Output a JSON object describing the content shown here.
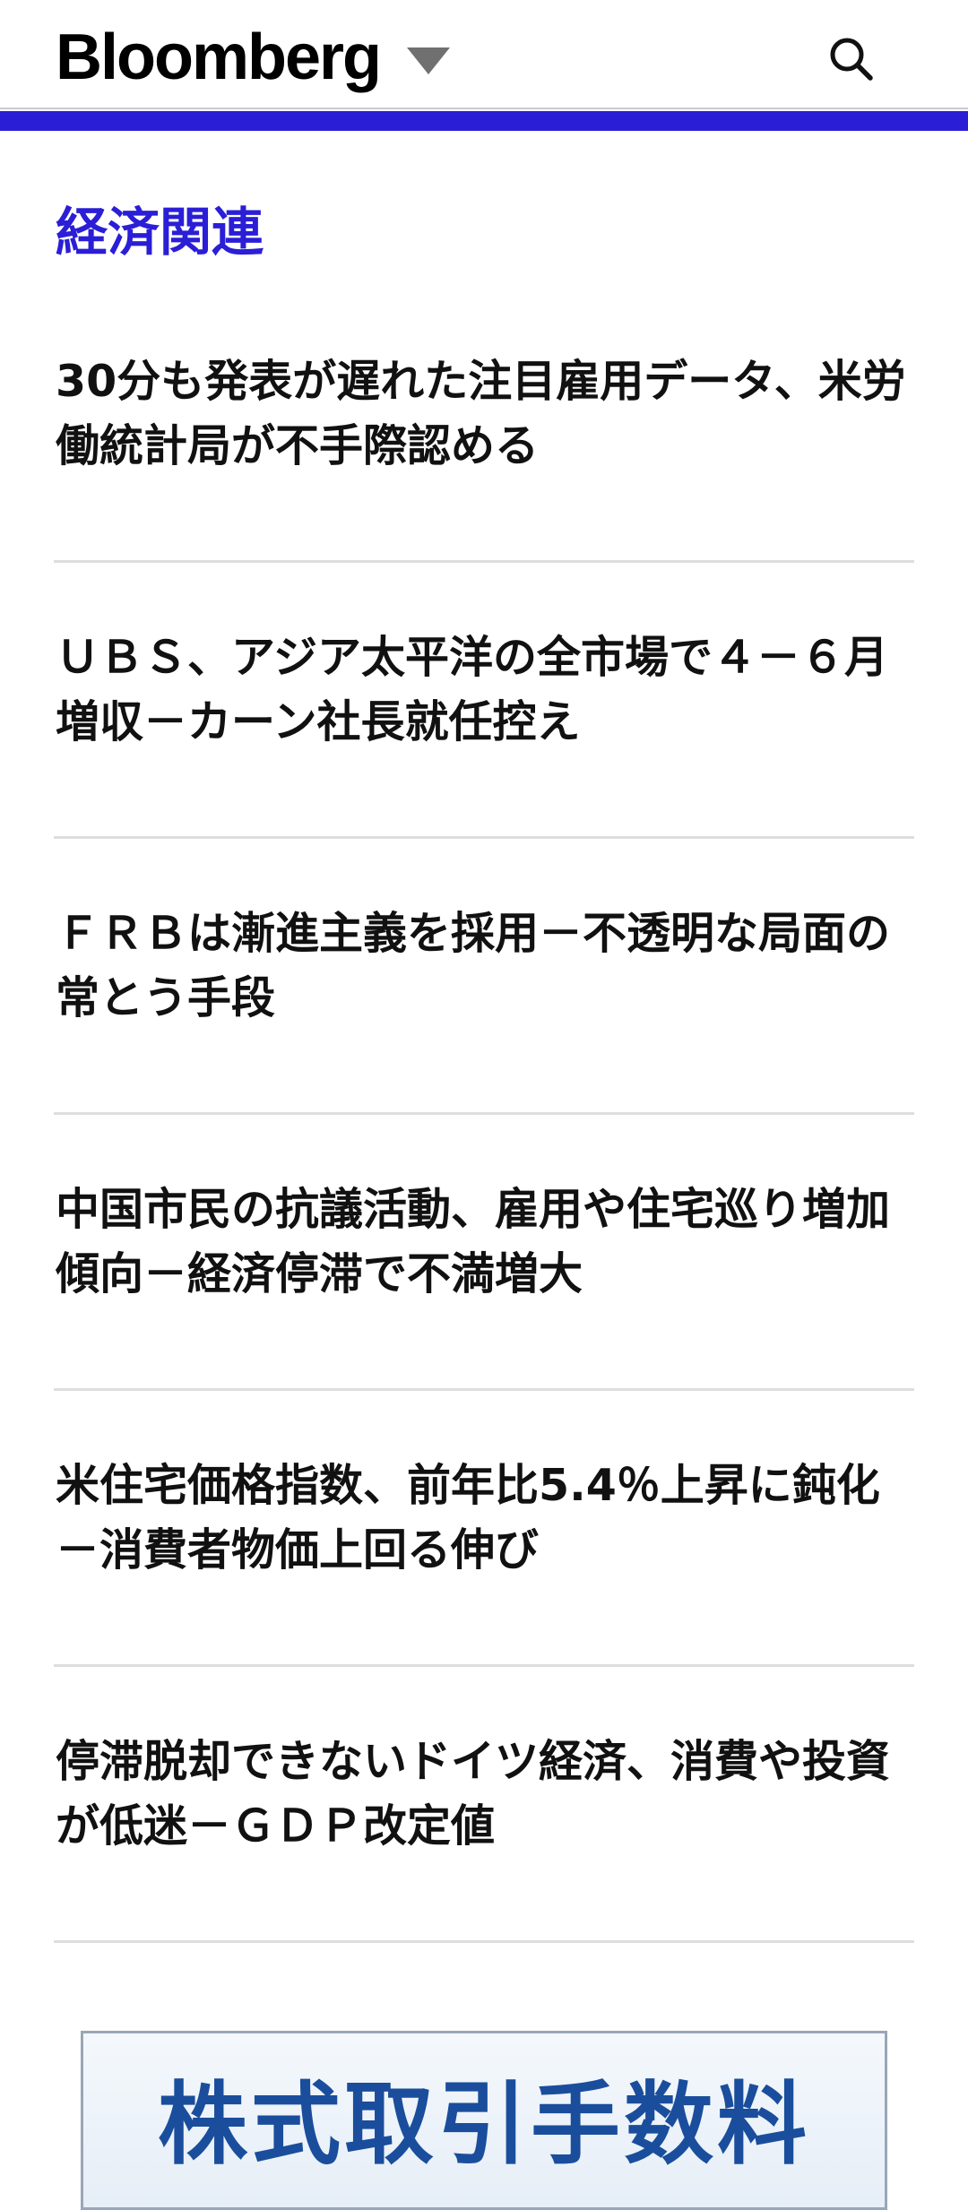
{
  "header": {
    "logo": "Bloomberg",
    "icons": {
      "menu_caret": "caret-down-icon",
      "search": "search-icon"
    },
    "accent_color": "#2a1ed6"
  },
  "section": {
    "title": "経済関連"
  },
  "articles": [
    {
      "headline": "30分も発表が遅れた注目雇用データ、米労働統計局が不手際認める"
    },
    {
      "headline": "ＵＢＳ、アジア太平洋の全市場で４－６月増収－カーン社長就任控え"
    },
    {
      "headline": "ＦＲＢは漸進主義を採用－不透明な局面の常とう手段"
    },
    {
      "headline": "中国市民の抗議活動、雇用や住宅巡り増加傾向－経済停滞で不満増大"
    },
    {
      "headline": "米住宅価格指数、前年比5.4％上昇に鈍化－消費者物価上回る伸び"
    },
    {
      "headline": "停滞脱却できないドイツ経済、消費や投資が低迷－ＧＤＰ改定値"
    }
  ],
  "ad": {
    "text": "株式取引手数料"
  }
}
